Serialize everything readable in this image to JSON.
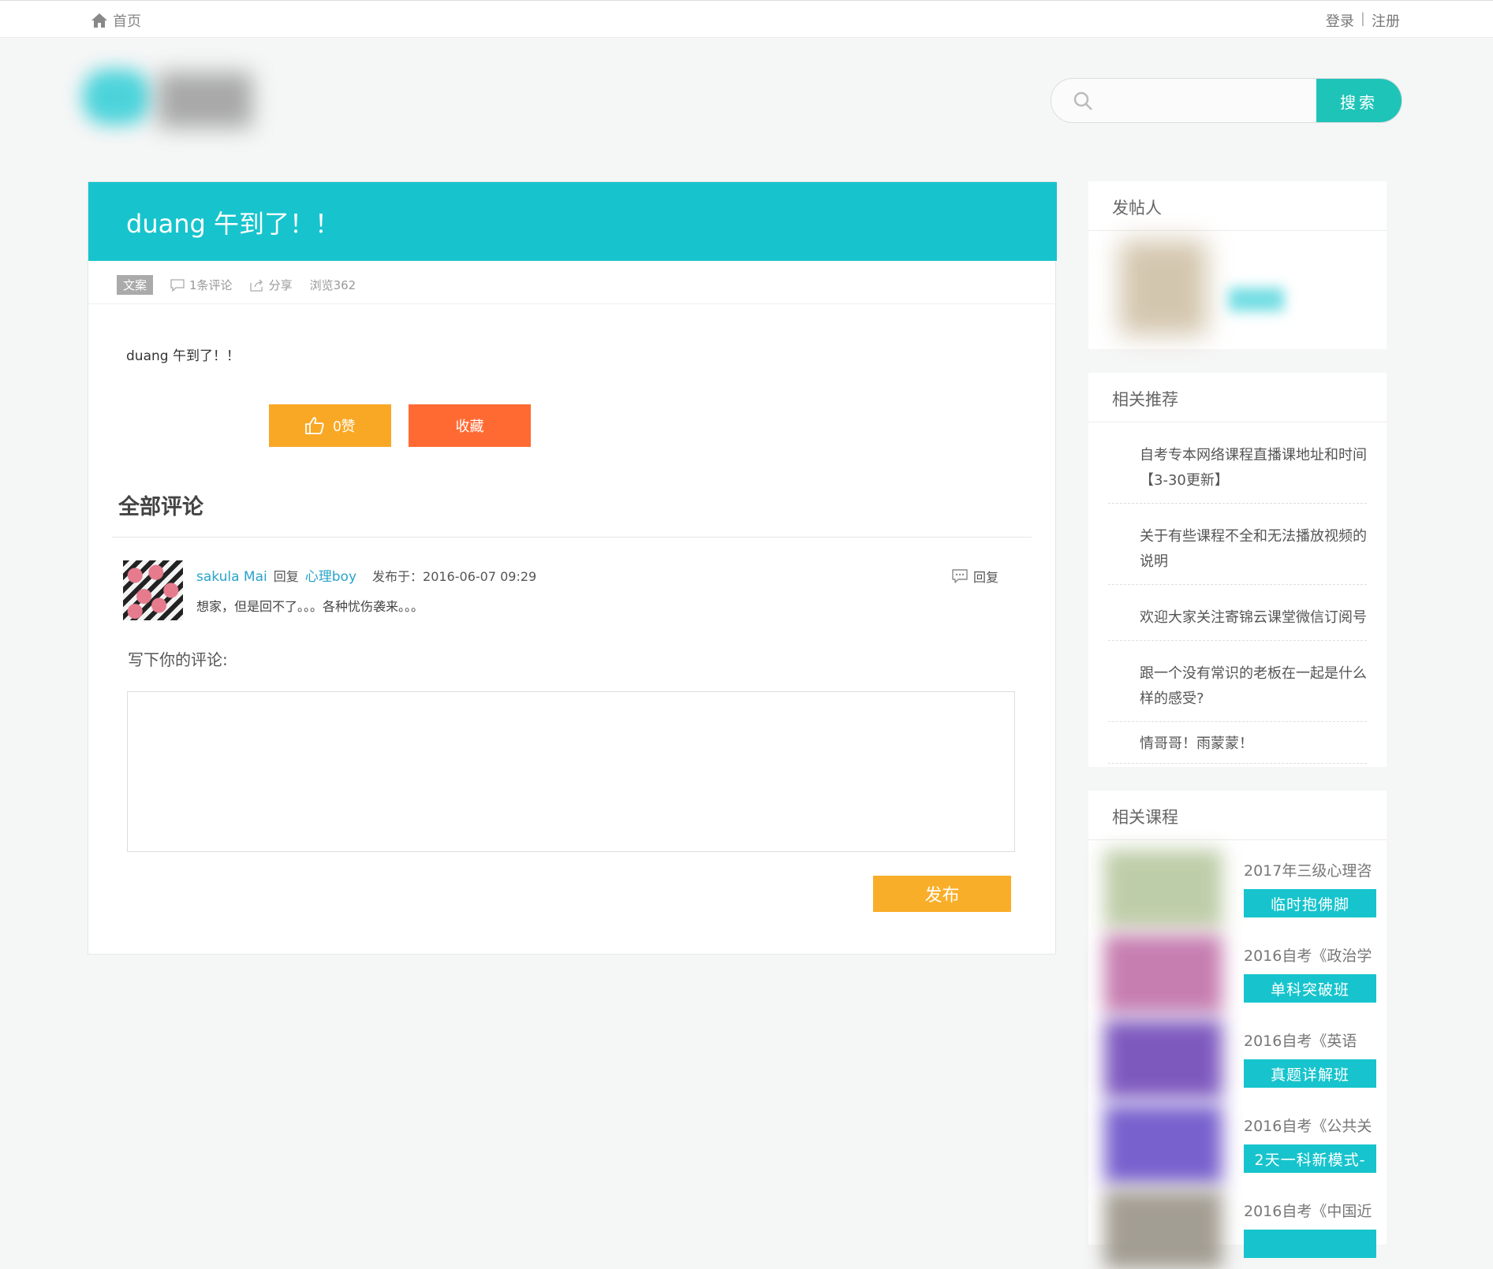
{
  "topbar": {
    "home_label": "首页",
    "login": "登录",
    "separator": "|",
    "register": "注册"
  },
  "search": {
    "placeholder": "",
    "button": "搜索"
  },
  "post": {
    "title": "duang 午到了！！",
    "tag": "文案",
    "comments_count": "1条评论",
    "share": "分享",
    "views": "浏览362",
    "body": "duang 午到了！！",
    "like_label": "0赞",
    "favorite_label": "收藏"
  },
  "comments": {
    "heading": "全部评论",
    "items": [
      {
        "user": "sakula Mai",
        "reply_word": "回复",
        "reply_to": "心理boy",
        "time": "发布于：2016-06-07 09:29",
        "text": "想家，但是回不了。。。各种忧伤袭来。。。",
        "reply_button": "回复"
      }
    ],
    "write_label": "写下你的评论:",
    "publish": "发布"
  },
  "sidebar": {
    "poster_title": "发帖人",
    "recommend_title": "相关推荐",
    "recommend_items": [
      "自考专本网络课程直播课地址和时间 【3-30更新】",
      "关于有些课程不全和无法播放视频的说明",
      "欢迎大家关注寄锦云课堂微信订阅号",
      "跟一个没有常识的老板在一起是什么样的感受?",
      "情哥哥！雨蒙蒙！"
    ],
    "course_title": "相关课程",
    "courses": [
      {
        "name": "2017年三级心理咨",
        "badge": "临时抱佛脚",
        "color": "#b8c8a0"
      },
      {
        "name": "2016自考《政治学",
        "badge": "单科突破班",
        "color": "#c070a8"
      },
      {
        "name": "2016自考《英语",
        "badge": "真题详解班",
        "color": "#7048b8"
      },
      {
        "name": "2016自考《公共关",
        "badge": "2天一科新模式-",
        "color": "#6a50c8"
      },
      {
        "name": "2016自考《中国近",
        "badge": "",
        "color": "#9a9488"
      }
    ]
  },
  "colors": {
    "primary_teal": "#17c4cd",
    "search_button": "#1fc4b8",
    "like_button": "#f9a825",
    "favorite_button": "#ff6a33",
    "publish_button": "#f9ae29",
    "link_blue": "#2aa3c9"
  }
}
